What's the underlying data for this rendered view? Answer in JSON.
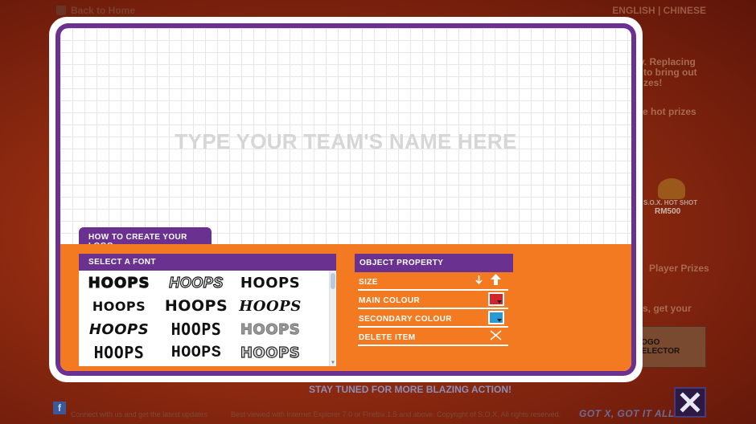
{
  "background": {
    "back_home": "Back to Home",
    "language": "ENGLISH  |  CHINESE",
    "side_text_1": "y. Replacing",
    "side_text_2": "to bring out",
    "side_text_3": "zes!",
    "hot_prizes": "e hot prizes",
    "badge_line_1": "S.O.X. HOT SHOT",
    "badge_line_2": "RM500",
    "player_prizes": "Player Prizes",
    "get_your": "s, get your",
    "logo_selector": "LOGO SELECTOR",
    "banner": "STAY TUNED FOR MORE BLAZING ACTION!",
    "footer_connect": "Connect with us and get the latest updates",
    "footer_copyright": "Best viewed with Internet Explorer 7.0 or Firefox 1.5 and above. Copyright of S.O.X. All rights reserved.",
    "tagline": "GOT X, GOT IT ALL"
  },
  "modal": {
    "placeholder": "TYPE YOUR TEAM'S NAME HERE",
    "how_to_tab": "HOW TO CREATE YOUR LOGO",
    "font_panel": {
      "title": "SELECT A FONT",
      "fonts": [
        "HOOPS",
        "HOOPS",
        "HOOPS",
        "HOOPS",
        "HOOPS",
        "HOOPS",
        "HOOPS",
        "HOOPS",
        "HOOPS",
        "HOOPS",
        "HOOPS",
        "HOOPS"
      ]
    },
    "property_panel": {
      "title": "OBJECT PROPERTY",
      "size_label": "SIZE",
      "main_colour_label": "MAIN COLOUR",
      "secondary_colour_label": "SECONDARY COLOUR",
      "delete_label": "DELETE ITEM"
    }
  },
  "colors": {
    "purple": "#6a3190",
    "orange": "#f47a21",
    "main_colour": "#d0262b",
    "secondary_colour": "#2a9ad6"
  }
}
